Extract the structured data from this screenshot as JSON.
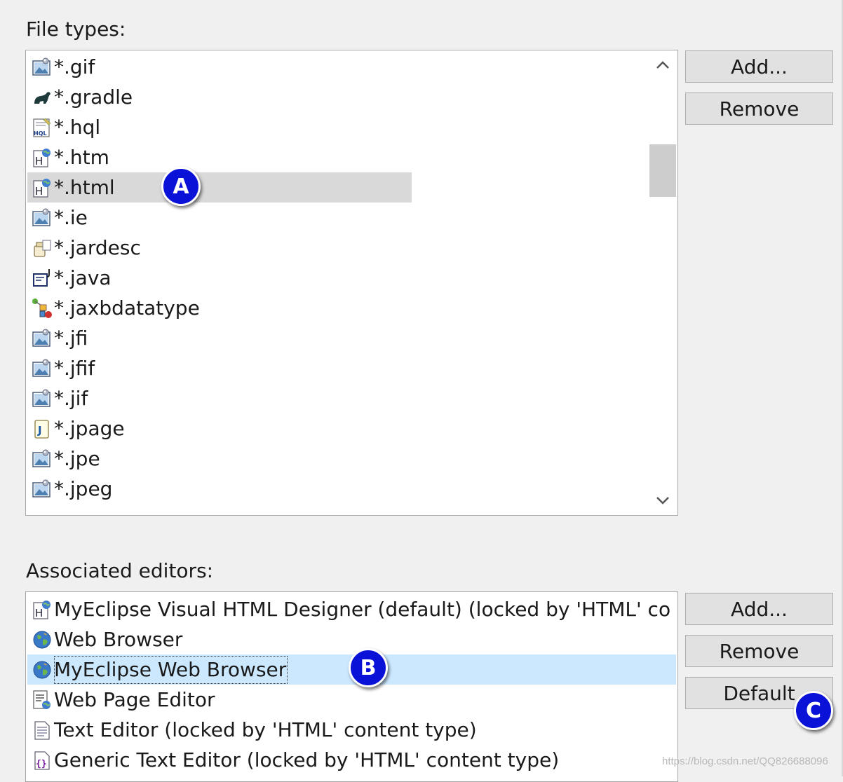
{
  "file_types_label": "File types:",
  "file_types": [
    {
      "label": "*.gif",
      "icon": "image-file-icon"
    },
    {
      "label": "*.gradle",
      "icon": "gradle-elephant-icon"
    },
    {
      "label": "*.hql",
      "icon": "hql-file-icon"
    },
    {
      "label": "*.htm",
      "icon": "html-file-icon"
    },
    {
      "label": "*.html",
      "icon": "html-file-icon",
      "selected": true
    },
    {
      "label": "*.ie",
      "icon": "image-file-icon"
    },
    {
      "label": "*.jardesc",
      "icon": "jar-description-icon"
    },
    {
      "label": "*.java",
      "icon": "java-file-icon"
    },
    {
      "label": "*.jaxbdatatype",
      "icon": "jaxb-datatype-icon"
    },
    {
      "label": "*.jfi",
      "icon": "image-file-icon"
    },
    {
      "label": "*.jfif",
      "icon": "image-file-icon"
    },
    {
      "label": "*.jif",
      "icon": "image-file-icon"
    },
    {
      "label": "*.jpage",
      "icon": "java-scrapbook-icon"
    },
    {
      "label": "*.jpe",
      "icon": "image-file-icon"
    },
    {
      "label": "*.jpeg",
      "icon": "image-file-icon"
    }
  ],
  "file_types_buttons": {
    "add": "Add...",
    "remove": "Remove"
  },
  "associated_editors_label": "Associated editors:",
  "editors": [
    {
      "label": "MyEclipse Visual HTML Designer (default) (locked by 'HTML' co",
      "icon": "html-file-icon"
    },
    {
      "label": "Web Browser",
      "icon": "globe-icon"
    },
    {
      "label": "MyEclipse Web Browser",
      "icon": "globe-icon",
      "selected": true
    },
    {
      "label": "Web Page Editor",
      "icon": "web-page-editor-icon"
    },
    {
      "label": "Text Editor (locked by 'HTML' content type)",
      "icon": "text-file-icon"
    },
    {
      "label": "Generic Text Editor (locked by 'HTML' content type)",
      "icon": "generic-editor-icon"
    }
  ],
  "editors_buttons": {
    "add": "Add...",
    "remove": "Remove",
    "default": "Default"
  },
  "badges": {
    "a": "A",
    "b": "B",
    "c": "C"
  },
  "watermark": "https://blog.csdn.net/QQ826688096",
  "colors": {
    "selection_gray": "#d9d9d9",
    "selection_blue": "#cce8ff",
    "badge_blue": "#0a12d8",
    "background": "#f0f0f0"
  }
}
